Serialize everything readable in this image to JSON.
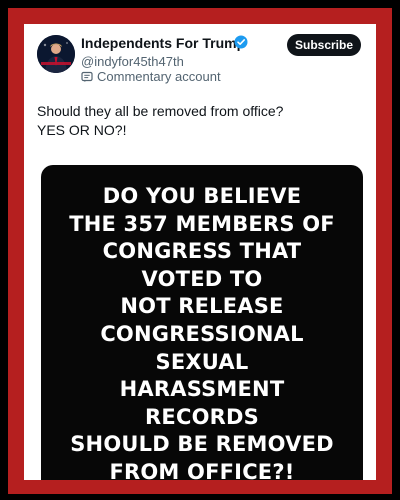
{
  "account": {
    "display_name": "Independents For Trump",
    "handle": "@indyfor45th47th",
    "label": "Commentary account"
  },
  "subscribe_label": "Subscribe",
  "post": {
    "lines": [
      "Should they all be removed from office?",
      "YES OR NO?!"
    ]
  },
  "meme": {
    "lines": [
      "DO YOU BELIEVE",
      "THE 357 MEMBERS OF",
      "CONGRESS THAT",
      "VOTED TO",
      "NOT RELEASE",
      "CONGRESSIONAL",
      "SEXUAL",
      "HARASSMENT",
      "RECORDS",
      "SHOULD BE REMOVED",
      "FROM OFFICE?!"
    ]
  },
  "icons": {
    "verified": "verified-badge-icon",
    "commentary": "commentary-account-icon"
  },
  "colors": {
    "frame": "#b51f1f",
    "verified": "#1d9bf0",
    "button": "#0f1419",
    "meme_bg": "#070707",
    "secondary_text": "#536471"
  }
}
